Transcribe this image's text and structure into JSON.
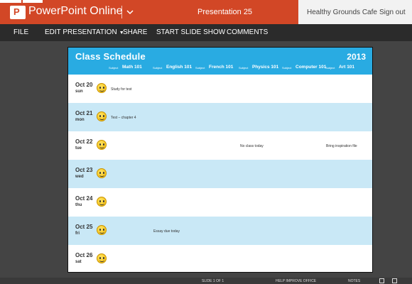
{
  "titlebar": {
    "app_title": "PowerPoint Online",
    "logo_letter": "P",
    "presentation_name": "Presentation 25",
    "user_name": "Healthy Grounds Cafe",
    "signout_label": "Sign out",
    "accent_color": "#d24726"
  },
  "ribbon": {
    "file": "FILE",
    "edit": "EDIT PRESENTATION",
    "share": "SHARE",
    "slideshow": "START SLIDE SHOW",
    "comments": "COMMENTS"
  },
  "slide": {
    "title": "Class Schedule",
    "year": "2013",
    "header_color": "#29abe2",
    "subject_label": "Subject",
    "subjects": [
      "Math 101",
      "English 101",
      "French 101",
      "Physics 101",
      "Computer 101",
      "Art 101"
    ],
    "days": [
      {
        "date": "Oct 20",
        "dow": "sun",
        "note1": "Study for test",
        "note2": "",
        "note3": ""
      },
      {
        "date": "Oct 21",
        "dow": "mon",
        "note1": "Test – chapter 4",
        "note2": "",
        "note3": ""
      },
      {
        "date": "Oct 22",
        "dow": "tue",
        "note1": "",
        "note2": "No class today",
        "note3": "Bring inspiration file"
      },
      {
        "date": "Oct 23",
        "dow": "wed",
        "note1": "",
        "note2": "",
        "note3": ""
      },
      {
        "date": "Oct 24",
        "dow": "thu",
        "note1": "",
        "note2": "",
        "note3": ""
      },
      {
        "date": "Oct 25",
        "dow": "fri",
        "note1": "Essay due today",
        "note2": "",
        "note3": ""
      },
      {
        "date": "Oct 26",
        "dow": "sat",
        "note1": "",
        "note2": "",
        "note3": ""
      }
    ]
  },
  "statusbar": {
    "slide_indicator": "SLIDE 1 OF 1",
    "help_text": "HELP IMPROVE OFFICE",
    "notes": "NOTES"
  }
}
